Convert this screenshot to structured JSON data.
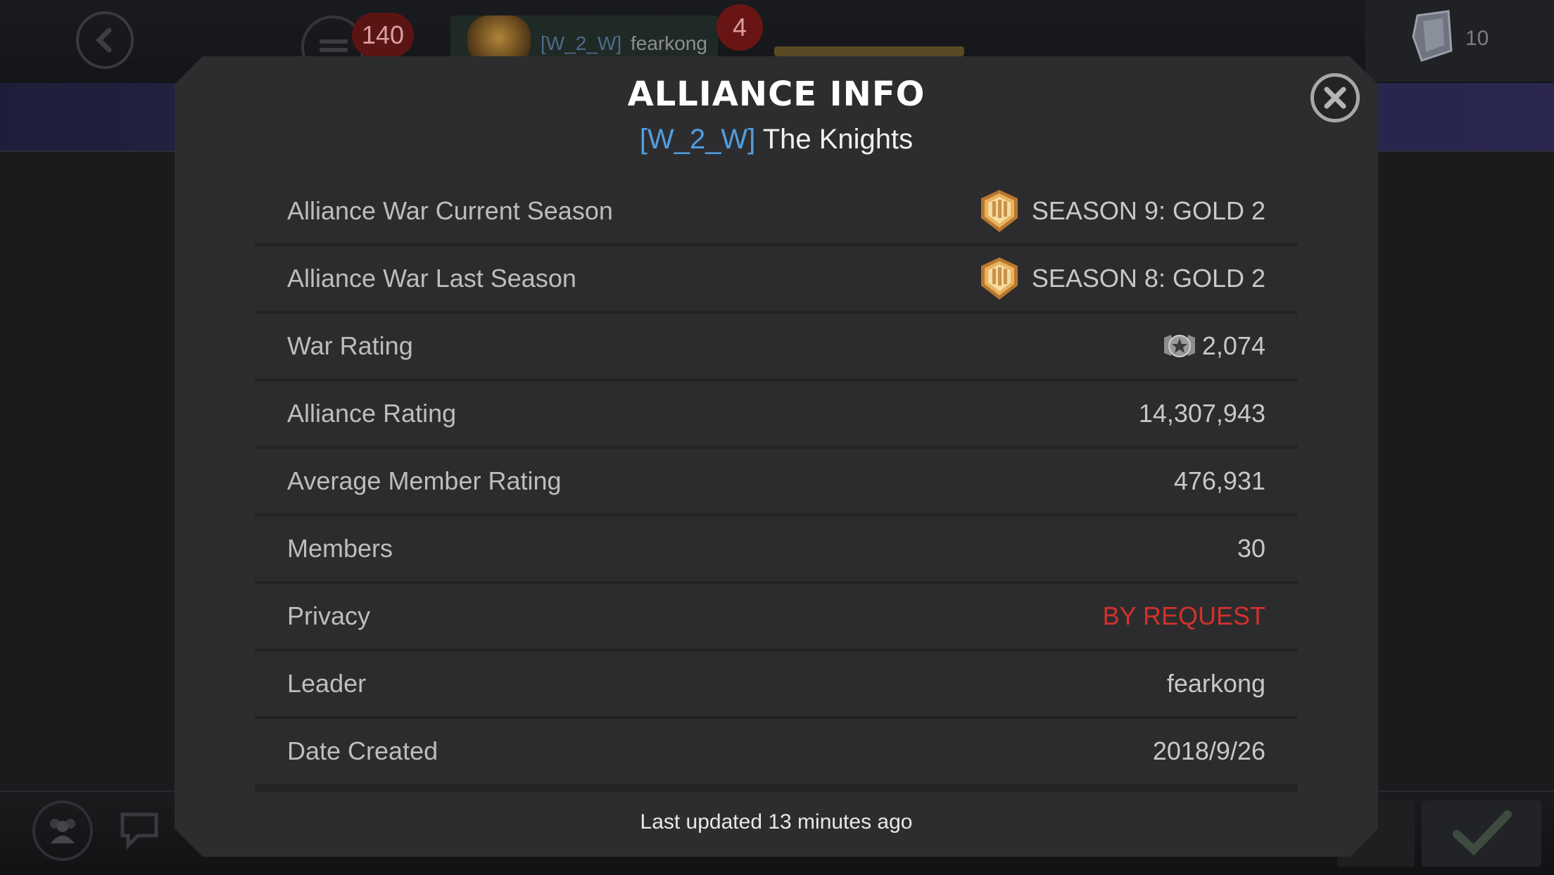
{
  "header": {
    "notification_count": "140",
    "player_tag": "[W_2_W]",
    "player_name": "fearkong",
    "player_badge": "4",
    "shard_count": "10"
  },
  "dialog": {
    "title": "ALLIANCE INFO",
    "alliance_tag": "[W_2_W]",
    "alliance_name": "The Knights",
    "rows": [
      {
        "label": "Alliance War Current Season",
        "value": "SEASON 9: GOLD 2",
        "icon": "gold-season-icon"
      },
      {
        "label": "Alliance War Last Season",
        "value": "SEASON 8: GOLD 2",
        "icon": "gold-season-icon"
      },
      {
        "label": "War Rating",
        "value": "2,074",
        "icon": "war-rating-icon"
      },
      {
        "label": "Alliance Rating",
        "value": "14,307,943"
      },
      {
        "label": "Average Member Rating",
        "value": "476,931"
      },
      {
        "label": "Members",
        "value": "30"
      },
      {
        "label": "Privacy",
        "value": "BY REQUEST",
        "value_color": "#d2312b"
      },
      {
        "label": "Leader",
        "value": "fearkong"
      },
      {
        "label": "Date Created",
        "value": "2018/9/26"
      }
    ],
    "footer": "Last updated 13 minutes ago"
  },
  "colors": {
    "accent_blue": "#4f9fe0",
    "privacy_red": "#d2312b",
    "dialog_bg": "#2d2d2f"
  }
}
